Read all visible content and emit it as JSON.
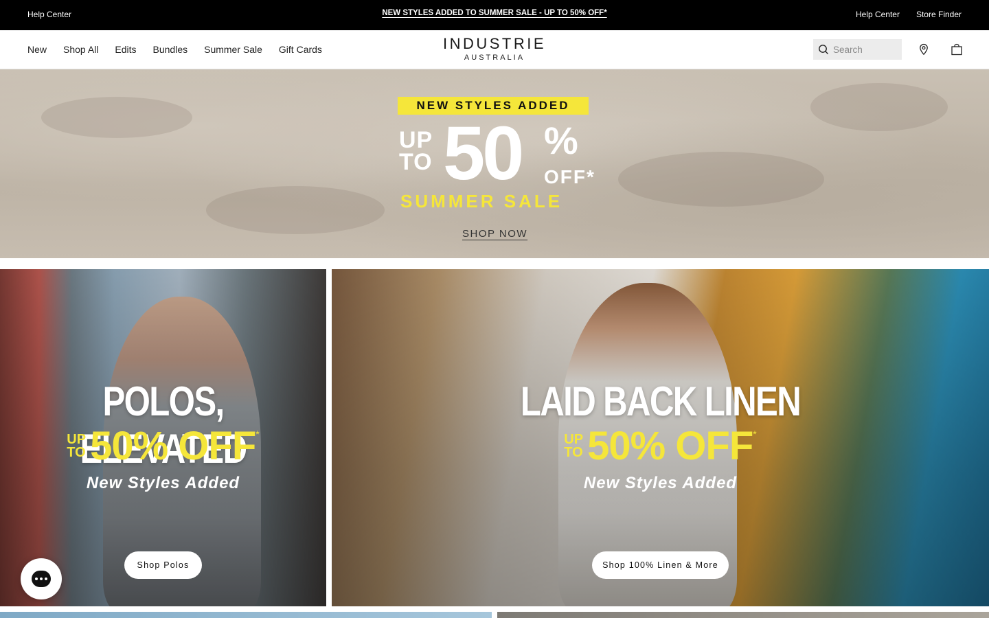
{
  "topbar": {
    "left_link": "Help Center",
    "announcement": "NEW STYLES ADDED TO SUMMER SALE - UP TO 50% OFF*",
    "right_links": [
      "Help Center",
      "Store Finder"
    ]
  },
  "header": {
    "nav": [
      "New",
      "Shop All",
      "Edits",
      "Bundles",
      "Summer Sale",
      "Gift Cards"
    ],
    "logo_line1": "INDUSTRIE",
    "logo_line2": "AUSTRALIA",
    "search_placeholder": "Search",
    "icons": [
      "search-icon",
      "location-pin-icon",
      "shopping-bag-icon"
    ]
  },
  "hero": {
    "tag": "NEW STYLES ADDED",
    "up_to": "UP TO",
    "amount": "50",
    "percent": "%",
    "off": "OFF*",
    "summer_sale": "SUMMER SALE",
    "cta": "SHOP NOW"
  },
  "panels": [
    {
      "headline": "POLOS, ELEVATED",
      "up": "UP",
      "to": "TO",
      "off": "50% OFF",
      "star": "*",
      "subtitle": "New Styles Added",
      "cta": "Shop Polos"
    },
    {
      "headline": "LAID BACK LINEN",
      "up": "UP",
      "to": "TO",
      "off": "50% OFF",
      "star": "*",
      "subtitle": "New Styles Added",
      "cta": "Shop 100% Linen & More"
    }
  ],
  "colors": {
    "accent_yellow": "#f5e63a",
    "topbar_bg": "#000000",
    "search_bg": "#ececec"
  }
}
